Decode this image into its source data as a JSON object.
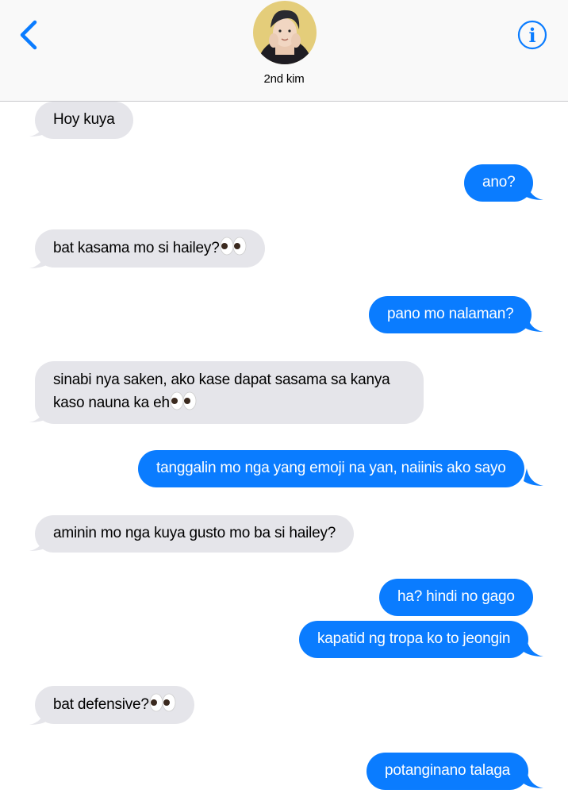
{
  "header": {
    "contact_name": "2nd kim",
    "back_icon": "chevron-left-icon",
    "info_icon": "info-circle-icon",
    "accent": "#0a7cff"
  },
  "messages": [
    {
      "dir": "in",
      "text": "Hoy kuya"
    },
    {
      "dir": "out",
      "text": "ano?"
    },
    {
      "dir": "in",
      "text": "bat kasama mo si hailey?",
      "emoji": "eyes"
    },
    {
      "dir": "out",
      "text": "pano mo nalaman?"
    },
    {
      "dir": "in",
      "text": "sinabi nya saken, ako kase dapat sasama sa kanya",
      "text2": "kaso nauna ka eh",
      "emoji": "eyes"
    },
    {
      "dir": "out",
      "text": "tanggalin mo nga yang emoji na yan, naiinis ako sayo"
    },
    {
      "dir": "in",
      "text": "aminin mo nga kuya gusto mo ba si hailey?"
    },
    {
      "dir": "out",
      "text": "ha? hindi no gago"
    },
    {
      "dir": "out",
      "text": "kapatid ng tropa ko to jeongin"
    },
    {
      "dir": "in",
      "text": "bat defensive?",
      "emoji": "eyes"
    },
    {
      "dir": "out",
      "text": "potanginano talaga"
    }
  ],
  "colors": {
    "incoming_bubble": "#e5e5ea",
    "outgoing_bubble": "#0a7cff"
  }
}
